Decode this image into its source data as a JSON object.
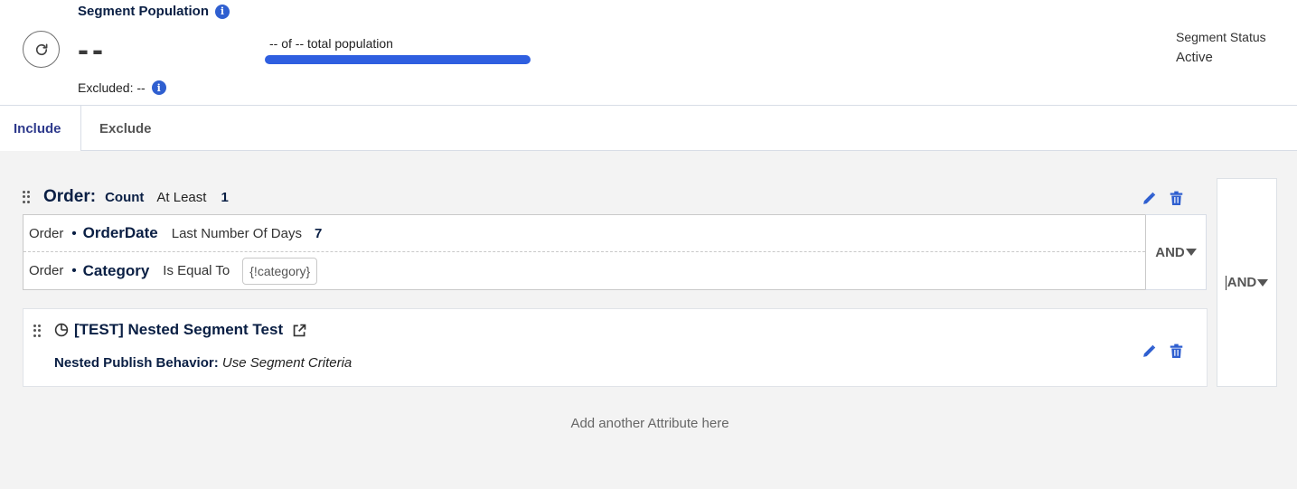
{
  "header": {
    "population_title": "Segment Population",
    "population_value": "--",
    "excluded_text": "Excluded: --",
    "total_text": "-- of -- total population",
    "status_label": "Segment Status",
    "status_value": "Active",
    "accent_color": "#2f5fe0"
  },
  "tabs": [
    {
      "label": "Include",
      "active": true
    },
    {
      "label": "Exclude",
      "active": false
    }
  ],
  "criteria": {
    "group": {
      "object": "Order:",
      "aggregate": "Count",
      "operator": "At Least",
      "value": "1",
      "conditions": [
        {
          "object": "Order",
          "bullet": "•",
          "field": "OrderDate",
          "operator": "Last Number Of Days",
          "value": "7"
        },
        {
          "object": "Order",
          "bullet": "•",
          "field": "Category",
          "operator": "Is Equal To",
          "value": "{!category}"
        }
      ],
      "inner_logic": "AND"
    },
    "nested_segment": {
      "name": "[TEST] Nested Segment Test",
      "behavior_label": "Nested Publish Behavior:",
      "behavior_value": "Use Segment Criteria"
    },
    "outer_logic": "AND",
    "add_attribute": "Add another Attribute here"
  }
}
